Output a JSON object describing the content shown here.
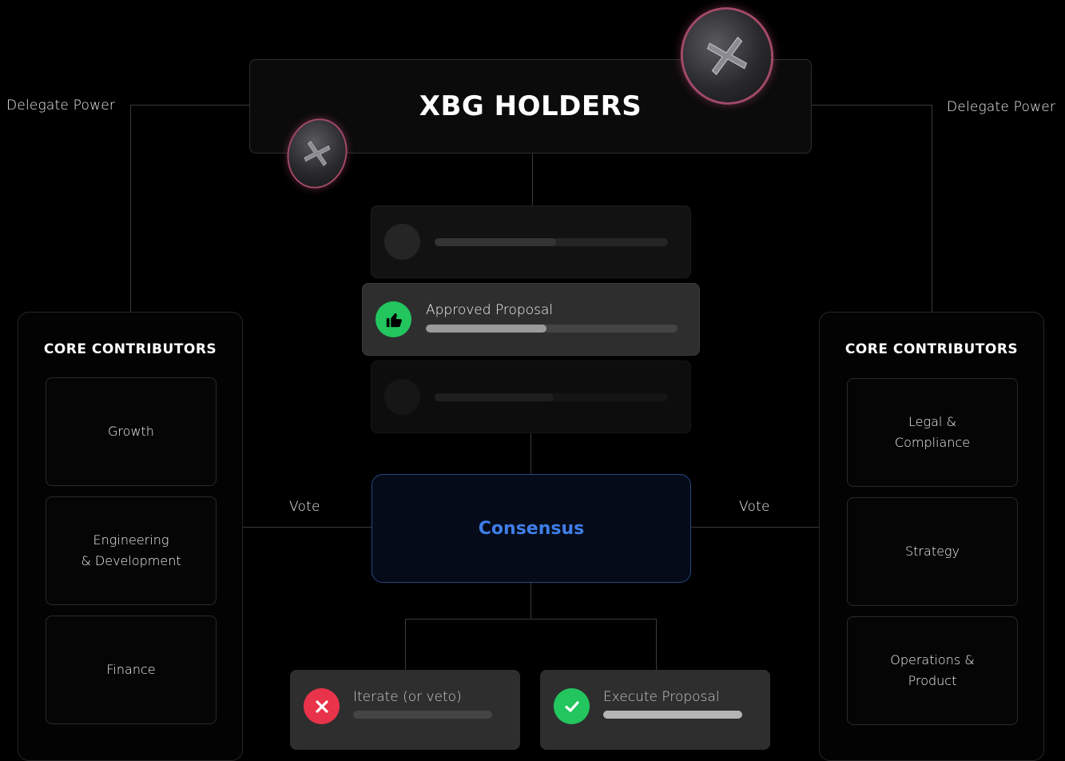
{
  "holders": {
    "title": "XBG HOLDERS"
  },
  "left_link": {
    "label": "Delegate Power"
  },
  "right_link": {
    "label": "Delegate Power"
  },
  "proposals": {
    "approved": {
      "label": "Approved Proposal",
      "progress": 0.48
    },
    "ghost_top_progress": 0.52,
    "ghost_bottom_progress": 0.51
  },
  "left_panel": {
    "title": "CORE CONTRIBUTORS",
    "cards": [
      "Growth",
      "Engineering\n& Development",
      "Finance"
    ]
  },
  "right_panel": {
    "title": "CORE CONTRIBUTORS",
    "cards": [
      "Legal &\nCompliance",
      "Strategy",
      "Operations &\nProduct"
    ]
  },
  "vote_left": {
    "label": "Vote"
  },
  "vote_right": {
    "label": "Vote"
  },
  "consensus": {
    "label": "Consensus"
  },
  "outcomes": {
    "iterate": {
      "label": "Iterate (or veto)",
      "icon": "x-icon",
      "color": "#e8334a"
    },
    "execute": {
      "label": "Execute Proposal",
      "icon": "check-icon",
      "color": "#22c55e"
    }
  },
  "colors": {
    "accent_blue": "#3f7ee8",
    "approve_green": "#22c55e",
    "reject_red": "#e8334a"
  }
}
